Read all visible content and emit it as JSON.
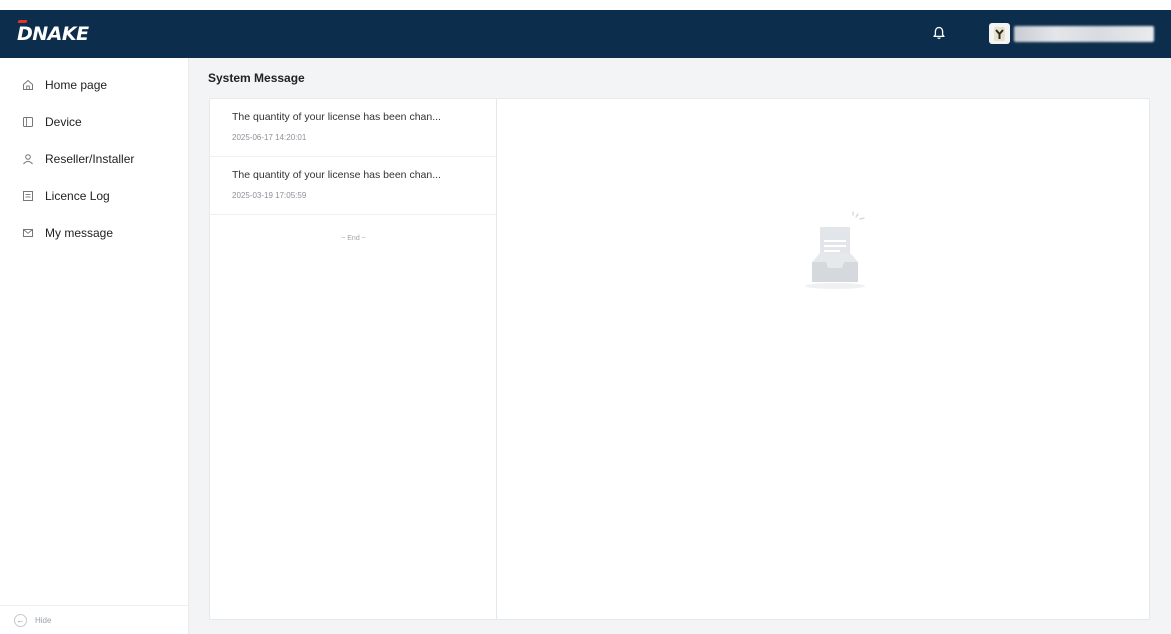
{
  "header": {
    "logo_text": "DNAKE",
    "username": "username",
    "bell_icon": "bell-icon",
    "brand_color": "#0c2d4b"
  },
  "sidebar": {
    "items": [
      {
        "label": "Home page",
        "icon": "home-icon"
      },
      {
        "label": "Device",
        "icon": "device-icon"
      },
      {
        "label": "Reseller/Installer",
        "icon": "user-icon"
      },
      {
        "label": "Licence Log",
        "icon": "log-icon"
      },
      {
        "label": "My message",
        "icon": "mail-icon"
      }
    ],
    "footer_label": "Hide",
    "footer_glyph": "←"
  },
  "main": {
    "title": "System Message",
    "messages": [
      {
        "title": "The quantity of your license has been chan...",
        "time": "2025-06-17 14:20:01"
      },
      {
        "title": "The quantity of your license has been chan...",
        "time": "2025-03-19 17:05:59"
      }
    ],
    "end_label": "~ End ~"
  }
}
